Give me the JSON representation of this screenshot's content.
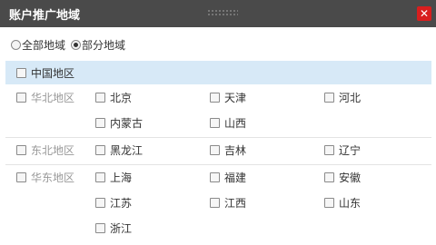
{
  "dialog": {
    "title": "账户推广地域",
    "close_symbol": "✕"
  },
  "scope": {
    "options": [
      {
        "label": "全部地域",
        "checked": false
      },
      {
        "label": "部分地域",
        "checked": true
      }
    ]
  },
  "china": {
    "label": "中国地区",
    "checked": false
  },
  "regions": [
    {
      "label": "华北地区",
      "provinces": [
        "北京",
        "天津",
        "河北",
        "内蒙古",
        "山西"
      ]
    },
    {
      "label": "东北地区",
      "provinces": [
        "黑龙江",
        "吉林",
        "辽宁"
      ]
    },
    {
      "label": "华东地区",
      "provinces": [
        "上海",
        "福建",
        "安徽",
        "江苏",
        "江西",
        "山东",
        "浙江"
      ]
    }
  ],
  "colors": {
    "titlebar": "#4a4a4a",
    "close": "#d81e1e",
    "highlight_row": "#d7e9f7",
    "muted_text": "#999999"
  }
}
